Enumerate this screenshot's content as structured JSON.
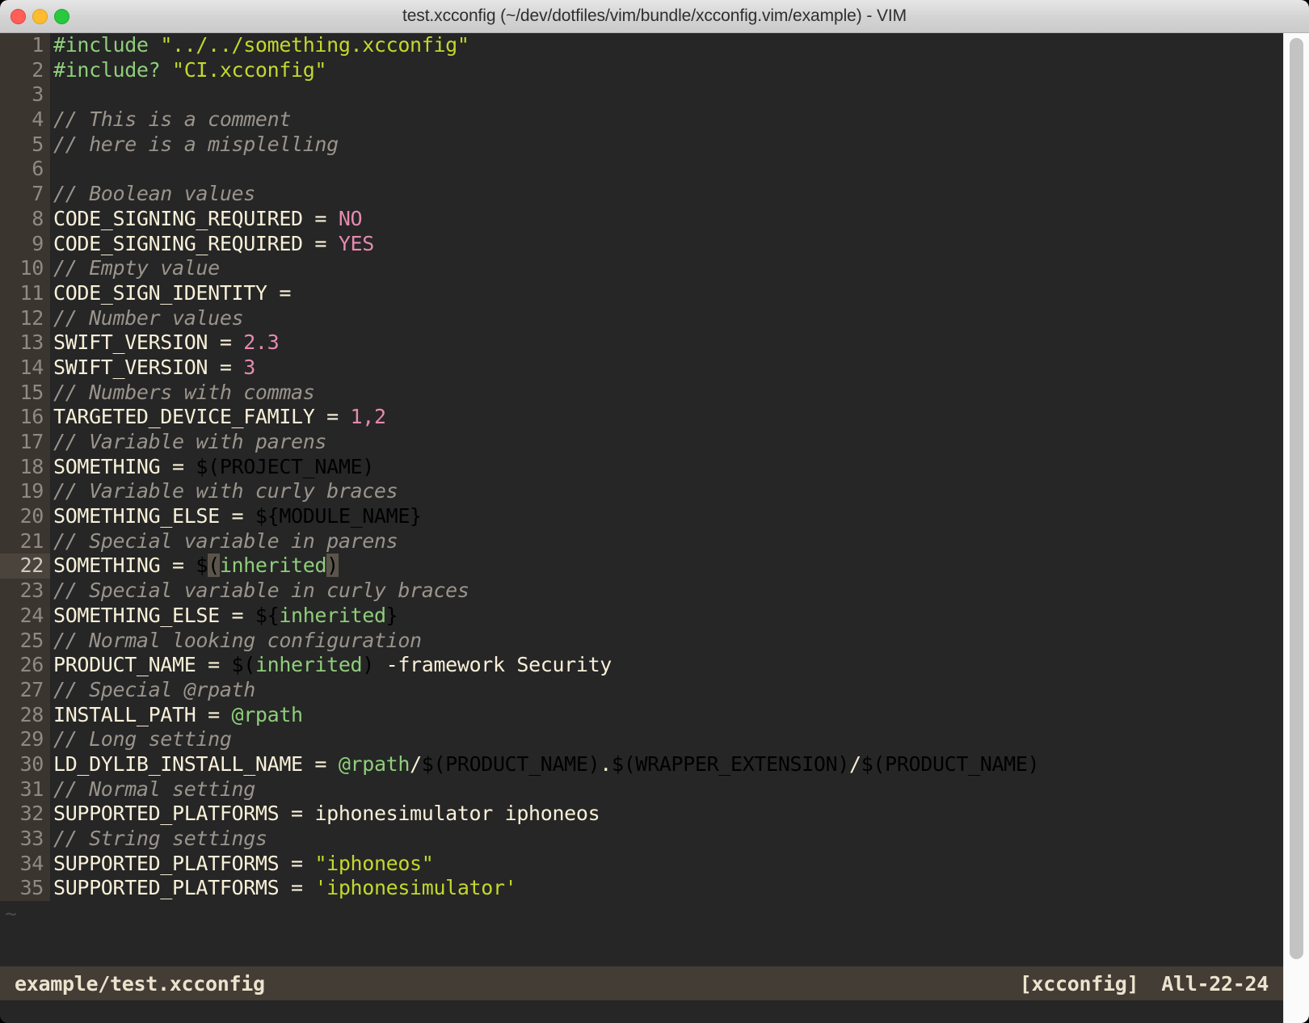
{
  "window": {
    "title": "test.xcconfig (~/dev/dotfiles/vim/bundle/xcconfig.vim/example) - VIM",
    "traffic_lights": [
      {
        "name": "close",
        "color": "#ff5f57"
      },
      {
        "name": "minimize",
        "color": "#febc2e"
      },
      {
        "name": "maximize",
        "color": "#28c840"
      }
    ]
  },
  "theme": {
    "background": "#262626",
    "gutter_bg": "#3a352f",
    "gutter_fg": "#908a80",
    "statusline_bg": "#433d35",
    "statusline_fg": "#ece3cf",
    "key": "#f8f0d8",
    "comment": "#9a948c",
    "string": "#c3d82c",
    "preproc": "#8fce7b",
    "number": "#e58ab0",
    "variable": "#77b1a9",
    "special": "#8fce7b",
    "paren_match_bg": "#5a544a",
    "tilde": "#4e4a44"
  },
  "editor": {
    "filetype": "xcconfig",
    "cursor_line": 22,
    "tilde_marker": "~",
    "lines": [
      {
        "n": "1",
        "tokens": [
          {
            "t": "#include ",
            "c": "preproc"
          },
          {
            "t": "\"../../something.xcconfig\"",
            "c": "string"
          }
        ]
      },
      {
        "n": "2",
        "tokens": [
          {
            "t": "#include? ",
            "c": "preproc"
          },
          {
            "t": "\"CI.xcconfig\"",
            "c": "string"
          }
        ]
      },
      {
        "n": "3",
        "tokens": []
      },
      {
        "n": "4",
        "tokens": [
          {
            "t": "// This is a comment",
            "c": "comment"
          }
        ]
      },
      {
        "n": "5",
        "tokens": [
          {
            "t": "// here is a misplelling",
            "c": "comment"
          }
        ]
      },
      {
        "n": "6",
        "tokens": []
      },
      {
        "n": "7",
        "tokens": [
          {
            "t": "// Boolean values",
            "c": "comment"
          }
        ]
      },
      {
        "n": "8",
        "tokens": [
          {
            "t": "CODE_SIGNING_REQUIRED = ",
            "c": "key"
          },
          {
            "t": "NO",
            "c": "number"
          }
        ]
      },
      {
        "n": "9",
        "tokens": [
          {
            "t": "CODE_SIGNING_REQUIRED = ",
            "c": "key"
          },
          {
            "t": "YES",
            "c": "number"
          }
        ]
      },
      {
        "n": "10",
        "tokens": [
          {
            "t": "// Empty value",
            "c": "comment"
          }
        ]
      },
      {
        "n": "11",
        "tokens": [
          {
            "t": "CODE_SIGN_IDENTITY =",
            "c": "key"
          }
        ]
      },
      {
        "n": "12",
        "tokens": [
          {
            "t": "// Number values",
            "c": "comment"
          }
        ]
      },
      {
        "n": "13",
        "tokens": [
          {
            "t": "SWIFT_VERSION = ",
            "c": "key"
          },
          {
            "t": "2.3",
            "c": "number"
          }
        ]
      },
      {
        "n": "14",
        "tokens": [
          {
            "t": "SWIFT_VERSION = ",
            "c": "key"
          },
          {
            "t": "3",
            "c": "number"
          }
        ]
      },
      {
        "n": "15",
        "tokens": [
          {
            "t": "// Numbers with commas",
            "c": "comment"
          }
        ]
      },
      {
        "n": "16",
        "tokens": [
          {
            "t": "TARGETED_DEVICE_FAMILY = ",
            "c": "key"
          },
          {
            "t": "1,2",
            "c": "number"
          }
        ]
      },
      {
        "n": "17",
        "tokens": [
          {
            "t": "// Variable with parens",
            "c": "comment"
          }
        ]
      },
      {
        "n": "18",
        "tokens": [
          {
            "t": "SOMETHING = ",
            "c": "key"
          },
          {
            "t": "$(PROJECT_NAME)",
            "c": "variable"
          }
        ]
      },
      {
        "n": "19",
        "tokens": [
          {
            "t": "// Variable with curly braces",
            "c": "comment"
          }
        ]
      },
      {
        "n": "20",
        "tokens": [
          {
            "t": "SOMETHING_ELSE = ",
            "c": "key"
          },
          {
            "t": "${MODULE_NAME}",
            "c": "variable"
          }
        ]
      },
      {
        "n": "21",
        "tokens": [
          {
            "t": "// Special variable in parens",
            "c": "comment"
          }
        ]
      },
      {
        "n": "22",
        "tokens": [
          {
            "t": "SOMETHING = ",
            "c": "key"
          },
          {
            "t": "$",
            "c": "variable"
          },
          {
            "t": "(",
            "c": "variable",
            "hl": true
          },
          {
            "t": "inherited",
            "c": "special"
          },
          {
            "t": ")",
            "c": "variable",
            "hl": true
          }
        ]
      },
      {
        "n": "23",
        "tokens": [
          {
            "t": "// Special variable in curly braces",
            "c": "comment"
          }
        ]
      },
      {
        "n": "24",
        "tokens": [
          {
            "t": "SOMETHING_ELSE = ",
            "c": "key"
          },
          {
            "t": "${",
            "c": "variable"
          },
          {
            "t": "inherited",
            "c": "special"
          },
          {
            "t": "}",
            "c": "variable"
          }
        ]
      },
      {
        "n": "25",
        "tokens": [
          {
            "t": "// Normal looking configuration",
            "c": "comment"
          }
        ]
      },
      {
        "n": "26",
        "tokens": [
          {
            "t": "PRODUCT_NAME = ",
            "c": "key"
          },
          {
            "t": "$(",
            "c": "variable"
          },
          {
            "t": "inherited",
            "c": "special"
          },
          {
            "t": ")",
            "c": "variable"
          },
          {
            "t": " -framework Security",
            "c": "plain"
          }
        ]
      },
      {
        "n": "27",
        "tokens": [
          {
            "t": "// Special @rpath",
            "c": "comment"
          }
        ]
      },
      {
        "n": "28",
        "tokens": [
          {
            "t": "INSTALL_PATH = ",
            "c": "key"
          },
          {
            "t": "@rpath",
            "c": "special"
          }
        ]
      },
      {
        "n": "29",
        "tokens": [
          {
            "t": "// Long setting",
            "c": "comment"
          }
        ]
      },
      {
        "n": "30",
        "tokens": [
          {
            "t": "LD_DYLIB_INSTALL_NAME = ",
            "c": "key"
          },
          {
            "t": "@rpath",
            "c": "special"
          },
          {
            "t": "/",
            "c": "plain"
          },
          {
            "t": "$(PRODUCT_NAME)",
            "c": "variable"
          },
          {
            "t": ".",
            "c": "plain"
          },
          {
            "t": "$(WRAPPER_EXTENSION)",
            "c": "variable"
          },
          {
            "t": "/",
            "c": "plain"
          },
          {
            "t": "$(PRODUCT_NAME)",
            "c": "variable"
          }
        ]
      },
      {
        "n": "31",
        "tokens": [
          {
            "t": "// Normal setting",
            "c": "comment"
          }
        ]
      },
      {
        "n": "32",
        "tokens": [
          {
            "t": "SUPPORTED_PLATFORMS = ",
            "c": "key"
          },
          {
            "t": "iphonesimulator iphoneos",
            "c": "plain"
          }
        ]
      },
      {
        "n": "33",
        "tokens": [
          {
            "t": "// String settings",
            "c": "comment"
          }
        ]
      },
      {
        "n": "34",
        "tokens": [
          {
            "t": "SUPPORTED_PLATFORMS = ",
            "c": "key"
          },
          {
            "t": "\"iphoneos\"",
            "c": "string"
          }
        ]
      },
      {
        "n": "35",
        "tokens": [
          {
            "t": "SUPPORTED_PLATFORMS = ",
            "c": "key"
          },
          {
            "t": "'iphonesimulator'",
            "c": "string"
          }
        ]
      }
    ]
  },
  "statusline": {
    "filename": "example/test.xcconfig",
    "filetype": "[xcconfig]",
    "position": "All-22-24"
  },
  "scrollbar": {
    "orientation": "vertical"
  }
}
